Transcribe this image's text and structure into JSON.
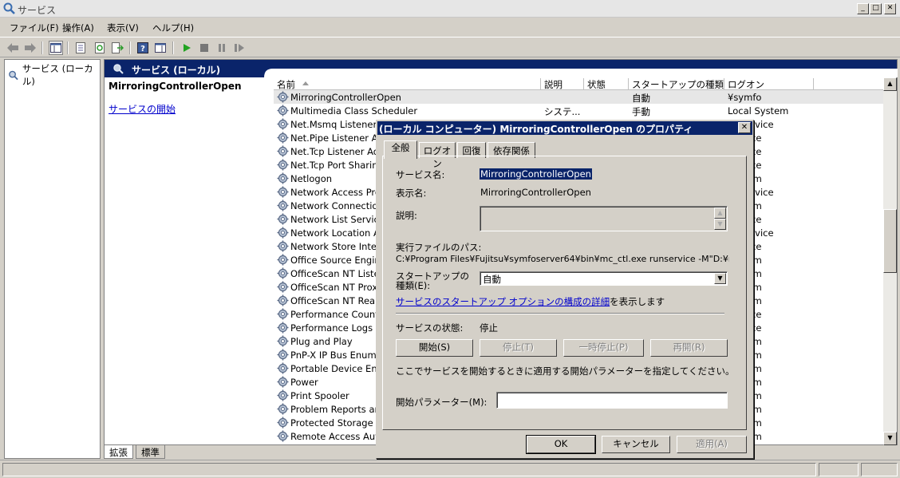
{
  "window": {
    "title": "サービス",
    "minimize": "_",
    "maximize": "□",
    "close": "✕"
  },
  "menu": [
    "ファイル(F)",
    "操作(A)",
    "表示(V)",
    "ヘルプ(H)"
  ],
  "tree": {
    "root": "サービス (ローカル)"
  },
  "panel": {
    "header": "サービス (ローカル)",
    "selected_name": "MirroringControllerOpen",
    "start_link": "サービスの開始"
  },
  "columns": [
    "名前",
    "説明",
    "状態",
    "スタートアップの種類",
    "ログオン"
  ],
  "services": [
    {
      "name": "MirroringControllerOpen",
      "desc": "",
      "state": "",
      "startup": "自動",
      "logon": "¥symfo"
    },
    {
      "name": "Multimedia Class Scheduler",
      "desc": "システ...",
      "state": "",
      "startup": "手動",
      "logon": "Local System"
    },
    {
      "name": "Net.Msmq Listener A",
      "desc": "",
      "state": "",
      "startup": "",
      "logon": "rk Service"
    },
    {
      "name": "Net.Pipe Listener Ad",
      "desc": "",
      "state": "",
      "startup": "",
      "logon": "Service"
    },
    {
      "name": "Net.Tcp Listener Ada",
      "desc": "",
      "state": "",
      "startup": "",
      "logon": "Service"
    },
    {
      "name": "Net.Tcp Port Sharing",
      "desc": "",
      "state": "",
      "startup": "",
      "logon": "Service"
    },
    {
      "name": "Netlogon",
      "desc": "",
      "state": "",
      "startup": "",
      "logon": "System"
    },
    {
      "name": "Network Access Pro",
      "desc": "",
      "state": "",
      "startup": "",
      "logon": "rk Service"
    },
    {
      "name": "Network Connections",
      "desc": "",
      "state": "",
      "startup": "",
      "logon": "System"
    },
    {
      "name": "Network List Service",
      "desc": "",
      "state": "",
      "startup": "",
      "logon": "Service"
    },
    {
      "name": "Network Location Aw",
      "desc": "",
      "state": "",
      "startup": "",
      "logon": "rk Service"
    },
    {
      "name": "Network Store Interfa",
      "desc": "",
      "state": "",
      "startup": "",
      "logon": "Service"
    },
    {
      "name": "Office Source Engine",
      "desc": "",
      "state": "",
      "startup": "",
      "logon": "System"
    },
    {
      "name": "OfficeScan NT Listen",
      "desc": "",
      "state": "",
      "startup": "",
      "logon": "System"
    },
    {
      "name": "OfficeScan NT Proxy",
      "desc": "",
      "state": "",
      "startup": "",
      "logon": "System"
    },
    {
      "name": "OfficeScan NT RealT",
      "desc": "",
      "state": "",
      "startup": "",
      "logon": "System"
    },
    {
      "name": "Performance Counter",
      "desc": "",
      "state": "",
      "startup": "",
      "logon": "Service"
    },
    {
      "name": "Performance Logs &",
      "desc": "",
      "state": "",
      "startup": "",
      "logon": "Service"
    },
    {
      "name": "Plug and Play",
      "desc": "",
      "state": "",
      "startup": "",
      "logon": "System"
    },
    {
      "name": "PnP-X IP Bus Enume",
      "desc": "",
      "state": "",
      "startup": "",
      "logon": "System"
    },
    {
      "name": "Portable Device Enu",
      "desc": "",
      "state": "",
      "startup": "",
      "logon": "System"
    },
    {
      "name": "Power",
      "desc": "",
      "state": "",
      "startup": "",
      "logon": "System"
    },
    {
      "name": "Print Spooler",
      "desc": "",
      "state": "",
      "startup": "",
      "logon": "System"
    },
    {
      "name": "Problem Reports and",
      "desc": "",
      "state": "",
      "startup": "",
      "logon": "System"
    },
    {
      "name": "Protected Storage",
      "desc": "",
      "state": "",
      "startup": "",
      "logon": "System"
    },
    {
      "name": "Remote Access Auto",
      "desc": "",
      "state": "",
      "startup": "",
      "logon": "System"
    }
  ],
  "bottom_tabs": [
    "拡張",
    "標準"
  ],
  "dialog": {
    "title": "(ローカル コンピューター) MirroringControllerOpen のプロパティ",
    "tabs": [
      "全般",
      "ログオン",
      "回復",
      "依存関係"
    ],
    "service_name_label": "サービス名:",
    "service_name": "MirroringControllerOpen",
    "display_name_label": "表示名:",
    "display_name": "MirroringControllerOpen",
    "description_label": "説明:",
    "exe_path_label": "実行ファイルのパス:",
    "exe_path": "C:¥Program Files¥Fujitsu¥symfoserver64¥bin¥mc_ctl.exe runservice -M\"D:¥mcdir¥",
    "startup_type_label_1": "スタートアップの",
    "startup_type_label_2": "種類(E):",
    "startup_type": "自動",
    "help_link": "サービスのスタートアップ オプションの構成の詳細",
    "help_suffix": "を表示します",
    "status_label": "サービスの状態:",
    "status_value": "停止",
    "btn_start": "開始(S)",
    "btn_stop": "停止(T)",
    "btn_pause": "一時停止(P)",
    "btn_resume": "再開(R)",
    "param_hint": "ここでサービスを開始するときに適用する開始パラメーターを指定してください。",
    "param_label": "開始パラメーター(M):",
    "param_value": "",
    "ok": "OK",
    "cancel": "キャンセル",
    "apply": "適用(A)"
  }
}
